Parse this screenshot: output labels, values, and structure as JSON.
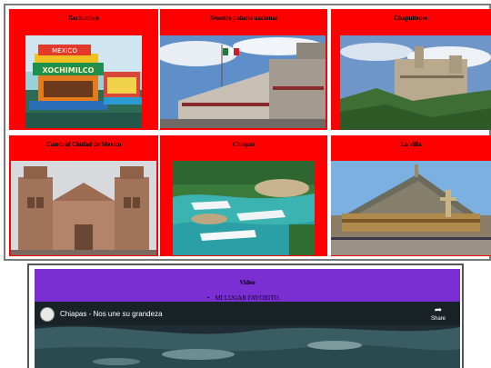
{
  "gallery": {
    "cards": [
      {
        "title": "Xochimilco",
        "image": "xochimilco-trajinera-photo"
      },
      {
        "title": "Nuestro palacio nacional",
        "image": "palacio-nacional-photo"
      },
      {
        "title": "Chapultepec",
        "image": "chapultepec-castle-photo"
      },
      {
        "title": "Catedral Ciudad de Mexico",
        "image": "catedral-photo"
      },
      {
        "title": "Chiapas",
        "image": "chiapas-waterfalls-photo"
      },
      {
        "title": "La villa",
        "image": "basilica-villa-photo"
      }
    ],
    "photo_texts": {
      "boat_banner": "MEXICO",
      "boat_name": "XOCHIMILCO"
    }
  },
  "video": {
    "heading": "Video",
    "list_item": "MI LUGAR FAVORITO.",
    "player": {
      "title": "Chiapas - Nos une su grandeza",
      "share_label": "Share",
      "share_icon": "share-arrow-icon"
    }
  },
  "colors": {
    "card_background": "#fe0000",
    "video_header": "#7b2fd3",
    "border": "#7a7a7a"
  }
}
